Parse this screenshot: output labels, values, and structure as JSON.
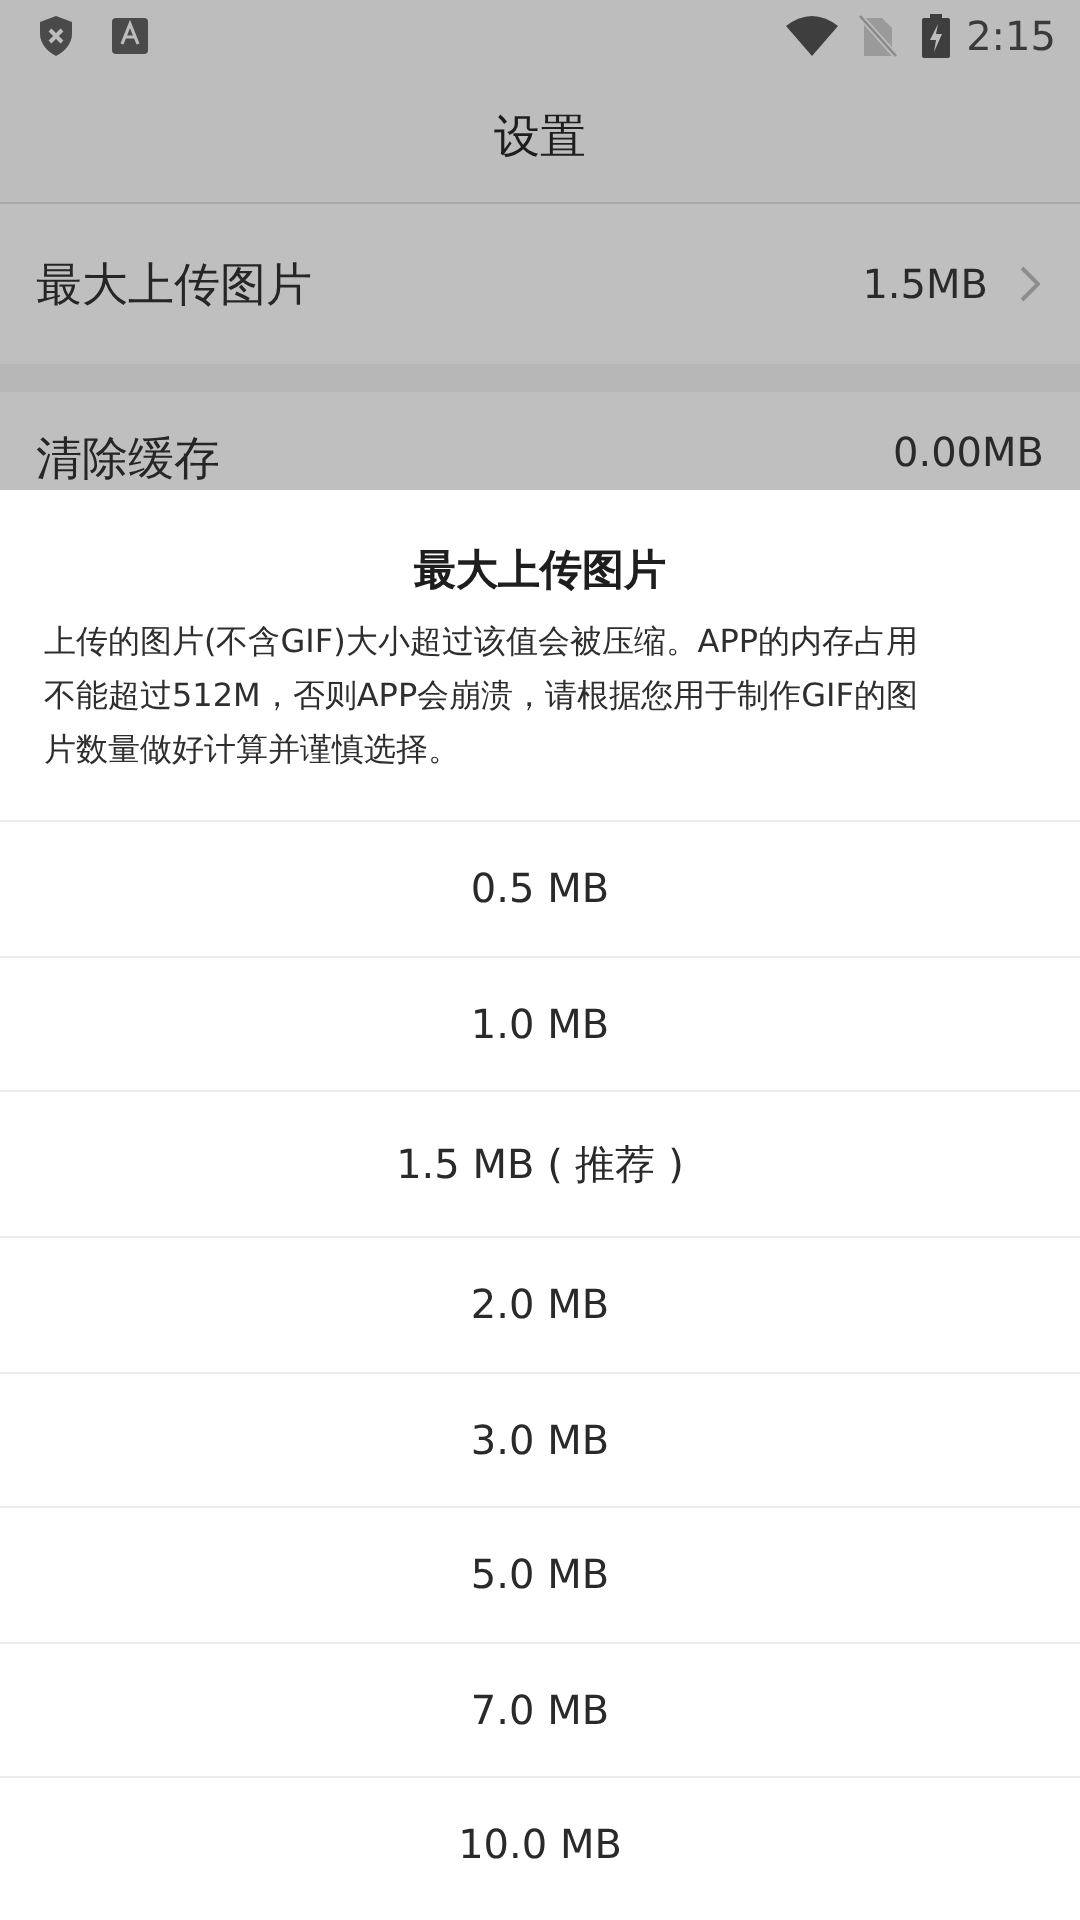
{
  "status_bar": {
    "time": "2:15"
  },
  "app_bar": {
    "title": "设置"
  },
  "settings": [
    {
      "label": "最大上传图片",
      "value": "1.5MB",
      "kind": "link"
    },
    {
      "label": "清除缓存",
      "value": "0.00MB",
      "kind": "plain"
    }
  ],
  "sheet": {
    "title": "最大上传图片",
    "description": "上传的图片(不含GIF)大小超过该值会被压缩。APP的内存占用不能超过512M，否则APP会崩溃，请根据您用于制作GIF的图片数量做好计算并谨慎选择。",
    "options": [
      {
        "label": "0.5 MB"
      },
      {
        "label": "1.0 MB"
      },
      {
        "label": "1.5 MB ( 推荐 )"
      },
      {
        "label": "2.0 MB"
      },
      {
        "label": "3.0 MB"
      },
      {
        "label": "5.0 MB"
      },
      {
        "label": "7.0 MB"
      },
      {
        "label": "10.0 MB"
      }
    ]
  }
}
